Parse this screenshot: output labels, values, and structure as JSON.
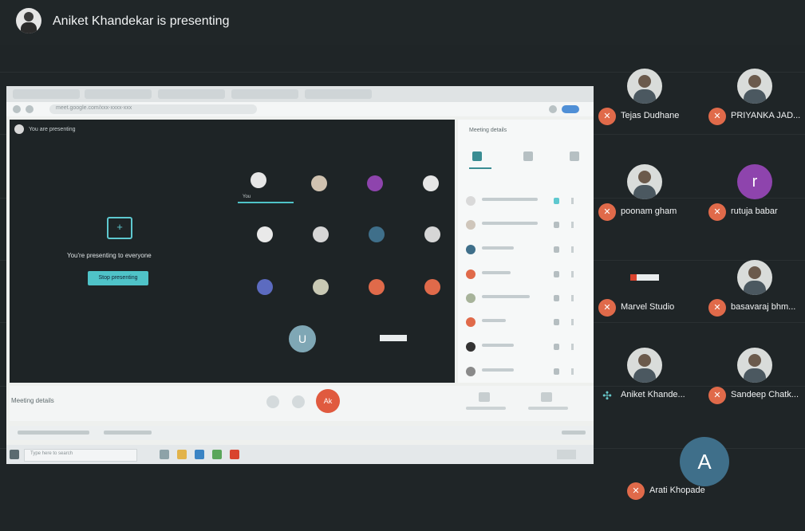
{
  "header": {
    "presenting_title": "Aniket Khandekar is presenting"
  },
  "shared_screen": {
    "url": "meet.google.com/xxx-xxxx-xxx",
    "stage": {
      "you_are_presenting": "You are presenting",
      "message": "You're presenting to everyone",
      "stop_button": "Stop presenting",
      "mini_tile_label": "You",
      "mini_big_letter": "U"
    },
    "people_panel": {
      "title": "Meeting details"
    },
    "bottom": {
      "meeting_details_label": "Meeting details",
      "end_label": "Ak"
    },
    "taskbar": {
      "search_placeholder": "Type here to search"
    }
  },
  "participants": [
    {
      "name": "Tejas Dudhane",
      "avatar": "photo",
      "status": "muted",
      "color": ""
    },
    {
      "name": "PRIYANKA JAD...",
      "avatar": "photo",
      "status": "muted",
      "color": ""
    },
    {
      "name": "poonam gham",
      "avatar": "photo",
      "status": "muted",
      "color": ""
    },
    {
      "name": "rutuja babar",
      "avatar": "letter",
      "letter": "r",
      "status": "muted",
      "color": "#8e44ad"
    },
    {
      "name": "Marvel Studio",
      "avatar": "banner",
      "status": "muted",
      "color": ""
    },
    {
      "name": "basavaraj bhm...",
      "avatar": "photo",
      "status": "muted",
      "color": ""
    },
    {
      "name": "Aniket Khande...",
      "avatar": "photo",
      "status": "presenting",
      "color": ""
    },
    {
      "name": "Sandeep Chatk...",
      "avatar": "photo",
      "status": "muted",
      "color": ""
    },
    {
      "name": "Arati Khopade",
      "avatar": "letter",
      "letter": "A",
      "status": "muted",
      "color": "#3f6f8a"
    }
  ],
  "colors": {
    "accent": "#4fc3c8",
    "muted_badge": "#e06a4a",
    "background": "#1f2527"
  }
}
